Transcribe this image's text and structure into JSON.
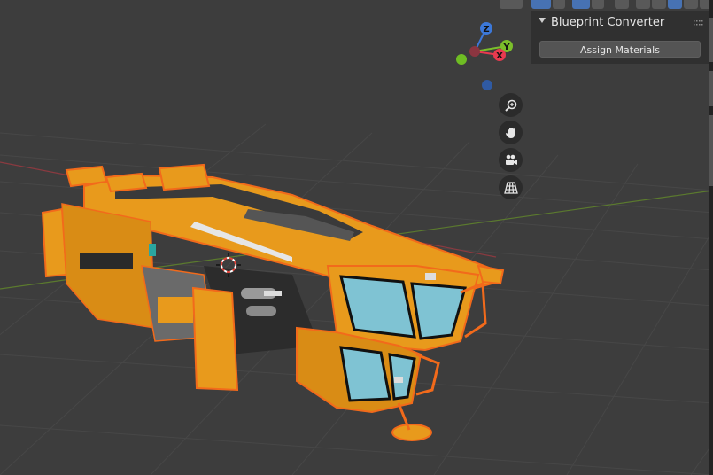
{
  "viewport": {
    "name": "3D Viewport"
  },
  "gizmo": {
    "x_label": "X",
    "y_label": "Y",
    "z_label": "Z"
  },
  "nav_buttons": {
    "zoom_icon": "zoom-icon",
    "pan_icon": "hand-icon",
    "camera_icon": "camera-icon",
    "ortho_icon": "grid-icon"
  },
  "npanel": {
    "panel_title": "Blueprint Converter",
    "assign_button": "Assign Materials"
  },
  "colors": {
    "background": "#3d3d3d",
    "panel": "#303030",
    "ship_body": "#e89a1c",
    "outline": "#f26a1b",
    "glass": "#7fc3d3",
    "x_axis": "#e83a4f",
    "y_axis": "#7bbf2a",
    "z_axis": "#3c78d8"
  }
}
